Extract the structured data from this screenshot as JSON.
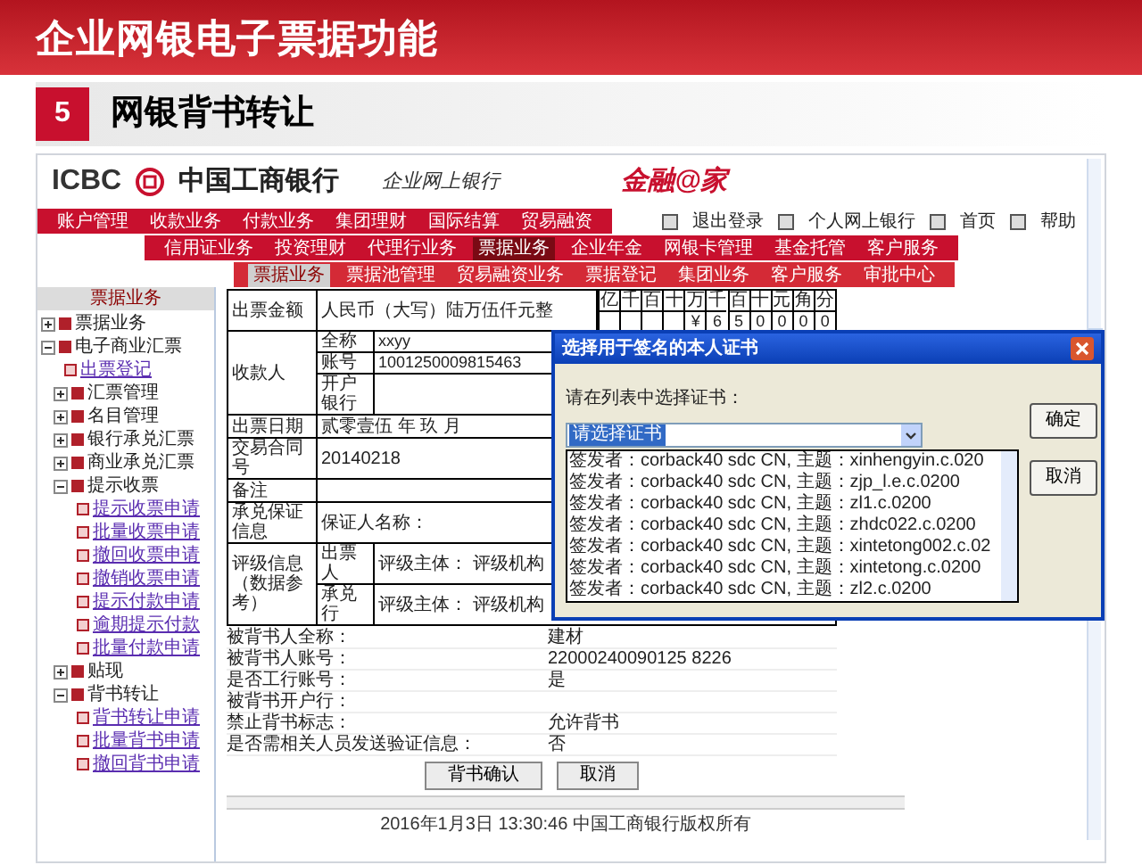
{
  "slide": {
    "title": "企业网银电子票据功能",
    "section_number": "5",
    "section_title": "网银背书转让"
  },
  "bank": {
    "logo_text": "ICBC",
    "name": "中国工商银行",
    "subtitle": "企业网上银行",
    "brand": "金融@家"
  },
  "top_links": [
    "退出登录",
    "个人网上银行",
    "首页",
    "帮助"
  ],
  "menu_rows": [
    [
      {
        "label": "账户管理",
        "selected": false
      },
      {
        "label": "收款业务",
        "selected": false
      },
      {
        "label": "付款业务",
        "selected": false
      },
      {
        "label": "集团理财",
        "selected": false
      },
      {
        "label": "国际结算",
        "selected": false
      },
      {
        "label": "贸易融资",
        "selected": false
      }
    ],
    [
      {
        "label": "信用证业务",
        "selected": false
      },
      {
        "label": "投资理财",
        "selected": false
      },
      {
        "label": "代理行业务",
        "selected": false
      },
      {
        "label": "票据业务",
        "selected": true
      },
      {
        "label": "企业年金",
        "selected": false
      },
      {
        "label": "网银卡管理",
        "selected": false
      },
      {
        "label": "基金托管",
        "selected": false
      },
      {
        "label": "客户服务",
        "selected": false
      }
    ],
    [
      {
        "label": "票据业务",
        "selected": true
      },
      {
        "label": "票据池管理",
        "selected": false
      },
      {
        "label": "贸易融资业务",
        "selected": false
      },
      {
        "label": "票据登记",
        "selected": false
      },
      {
        "label": "集团业务",
        "selected": false
      },
      {
        "label": "客户服务",
        "selected": false
      },
      {
        "label": "审批中心",
        "selected": false
      }
    ]
  ],
  "sidebar": {
    "title": "票据业务",
    "items": [
      {
        "label": "票据业务",
        "kind": "folder",
        "expanded": false
      },
      {
        "label": "电子商业汇票",
        "kind": "folder",
        "expanded": true,
        "children": [
          {
            "label": "出票登记",
            "kind": "link"
          },
          {
            "label": "汇票管理",
            "kind": "folder",
            "expanded": false
          },
          {
            "label": "名目管理",
            "kind": "folder",
            "expanded": false
          },
          {
            "label": "银行承兑汇票",
            "kind": "folder",
            "expanded": false
          },
          {
            "label": "商业承兑汇票",
            "kind": "folder",
            "expanded": false
          },
          {
            "label": "提示收票",
            "kind": "folder",
            "expanded": true,
            "children": [
              {
                "label": "提示收票申请",
                "kind": "link"
              },
              {
                "label": "批量收票申请",
                "kind": "link"
              },
              {
                "label": "撤回收票申请",
                "kind": "link"
              },
              {
                "label": "撤销收票申请",
                "kind": "link"
              },
              {
                "label": "提示付款申请",
                "kind": "link"
              },
              {
                "label": "逾期提示付款",
                "kind": "link"
              },
              {
                "label": "批量付款申请",
                "kind": "link"
              }
            ]
          },
          {
            "label": "贴现",
            "kind": "folder",
            "expanded": false
          },
          {
            "label": "背书转让",
            "kind": "folder",
            "expanded": true,
            "children": [
              {
                "label": "背书转让申请",
                "kind": "link"
              },
              {
                "label": "批量背书申请",
                "kind": "link"
              },
              {
                "label": "撤回背书申请",
                "kind": "link"
              }
            ]
          }
        ]
      }
    ]
  },
  "form": {
    "amount": {
      "label": "出票金额",
      "value": "人民币（大写）陆万伍仟元整",
      "digit_heads": [
        "亿",
        "千",
        "百",
        "十",
        "万",
        "千",
        "百",
        "十",
        "元",
        "角",
        "分"
      ],
      "digits": [
        "¥",
        "6",
        "5",
        "0",
        "0",
        "0",
        "0"
      ]
    },
    "payee": {
      "label": "收款人",
      "fields": [
        {
          "label": "全称",
          "value": "xxyy"
        },
        {
          "label": "账号",
          "value": "1001250009815463"
        },
        {
          "label": "开户银行"
        }
      ]
    },
    "rows": [
      {
        "label": "出票日期",
        "value": "贰零壹伍 年 玖 月"
      },
      {
        "label": "交易合同号",
        "value": "20140218"
      },
      {
        "label": "备注"
      },
      {
        "label": "承兑保证信息",
        "value": "保证人名称："
      }
    ],
    "rating": {
      "label": "评级信息（数据参考）",
      "rows": [
        {
          "label": "出票人",
          "parts": [
            "评级主体：",
            "评级机构"
          ]
        },
        {
          "label": "承兑行",
          "parts": [
            "评级主体：",
            "评级机构"
          ]
        }
      ]
    },
    "endorse_fields": [
      {
        "label": "被背书人全称：",
        "value": "建材"
      },
      {
        "label": "被背书人账号：",
        "value": "22000240090125 8226"
      },
      {
        "label": "是否工行账号：",
        "value": "是"
      },
      {
        "label": "被背书开户行："
      },
      {
        "label": "禁止背书标志：",
        "value": "允许背书"
      },
      {
        "label": "是否需相关人员发送验证信息：",
        "value": "否"
      }
    ],
    "buttons": [
      "背书确认",
      "取消"
    ]
  },
  "footer": "2016年1月3日 13:30:46  中国工商银行版权所有",
  "dialog": {
    "title": "选择用于签名的本人证书",
    "prompt": "请在列表中选择证书：",
    "select_value": "请选择证书",
    "buttons": [
      "确定",
      "取消"
    ],
    "options": [
      "签发者：corback40 sdc CN, 主题：xinhengyin.c.020",
      "签发者：corback40 sdc CN, 主题：zjp_l.e.c.0200",
      "签发者：corback40 sdc CN, 主题：zl1.c.0200",
      "签发者：corback40 sdc CN, 主题：zhdc022.c.0200",
      "签发者：corback40 sdc CN, 主题：xintetong002.c.02",
      "签发者：corback40 sdc CN, 主题：xintetong.c.0200",
      "签发者：corback40 sdc CN, 主题：zl2.c.0200"
    ]
  }
}
